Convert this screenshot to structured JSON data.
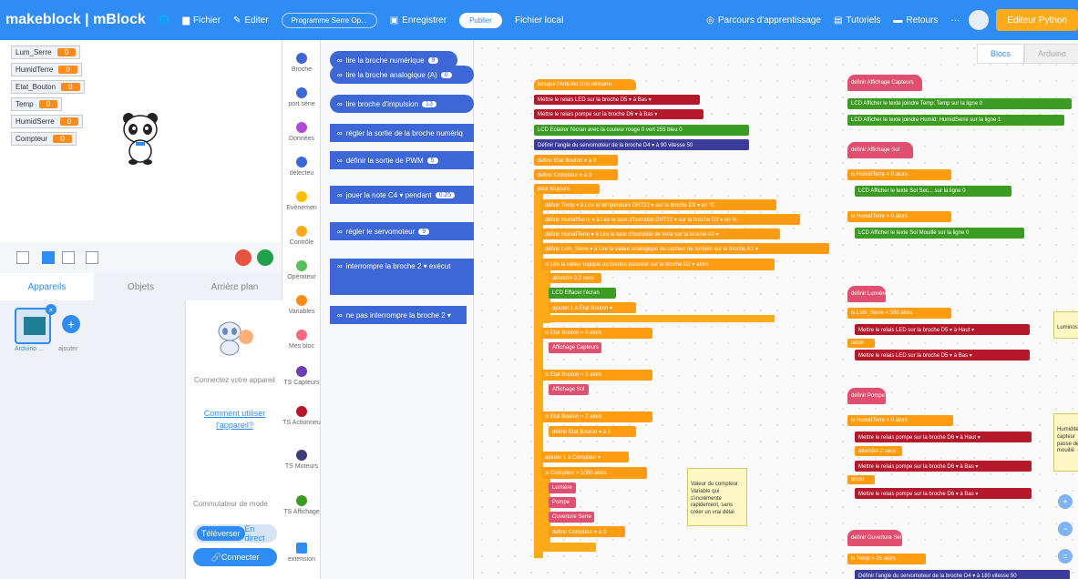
{
  "topbar": {
    "brand": "makeblock | mBlock",
    "menu_file": "Fichier",
    "menu_edit": "Editer",
    "project_name": "Programme Serre Op...",
    "save": "Enregistrer",
    "publish": "Publier",
    "local_file": "Fichier local",
    "learning": "Parcours d'apprentissage",
    "tutorials": "Tutoriels",
    "feedback": "Retours",
    "more": "···",
    "python_editor": "Editeur Python"
  },
  "variables": [
    {
      "name": "Lum_Serre",
      "value": "0"
    },
    {
      "name": "HumidTerre",
      "value": "0"
    },
    {
      "name": "Etat_Bouton",
      "value": "0"
    },
    {
      "name": "Temp",
      "value": "0"
    },
    {
      "name": "HumidSerre",
      "value": "0"
    },
    {
      "name": "Compteur",
      "value": "0"
    }
  ],
  "tabs": {
    "devices": "Appareils",
    "objects": "Objets",
    "background": "Arrière plan"
  },
  "devices": {
    "device_label": "Arduino ...",
    "add_label": "ajouter",
    "connect_text": "Connectez votre appareil",
    "how_to_link": "Comment utiliser l'appareil?",
    "mode_switch": "Commutateur de mode",
    "upload": "Téléverser",
    "live": "En direct",
    "connect_button": "Connecter"
  },
  "categories": [
    {
      "label": "Broche",
      "color": "#3d67d6"
    },
    {
      "label": "port série",
      "color": "#3d67d6"
    },
    {
      "label": "Données",
      "color": "#b04ad6"
    },
    {
      "label": "délecteu",
      "color": "#3d67d6"
    },
    {
      "label": "Evènemen",
      "color": "#ffbf00"
    },
    {
      "label": "Contrôle",
      "color": "#ffab19"
    },
    {
      "label": "Opérateur",
      "color": "#59c059"
    },
    {
      "label": "Variables",
      "color": "#ff8c1a"
    },
    {
      "label": "Mes bloc",
      "color": "#ff6680"
    },
    {
      "label": "TS Capteurs",
      "color": "#6d3eb5"
    },
    {
      "label": "TS Actionneu",
      "color": "#b5182a"
    },
    {
      "label": "TS Moteurs",
      "color": "#3c3c7b"
    },
    {
      "label": "TS Affichage",
      "color": "#3b9b22"
    },
    {
      "label": "extension",
      "color": "#2f8cf4"
    }
  ],
  "palette_blocks": [
    {
      "text": "lire la broche numérique",
      "value": "9"
    },
    {
      "text": "lire la broche analogique (A)",
      "value": "0"
    },
    {
      "text": "lire broche d'impulsion",
      "value": "13"
    },
    {
      "text": "régler la sortie de la broche numériq",
      "value": ""
    },
    {
      "text": "définir la sortie de PWM",
      "value": "5"
    },
    {
      "text": "jouer la note C4 ▾ pendant",
      "value": "0.25"
    },
    {
      "text": "régler le servomoteur",
      "value": "9"
    },
    {
      "text": "interrompre la broche 2 ▾ exécut",
      "value": ""
    },
    {
      "text": "ne pas interrompre la broche 2 ▾",
      "value": ""
    }
  ],
  "workspace_tabs": {
    "blocks": "Blocs",
    "arduino": "Arduino"
  },
  "main_script": [
    "lorsque l'Arduino Uno démarre",
    "Mettre le relais LED sur la broche D5 ▾ à Bas ▾",
    "Mettre le relais pompe sur la broche D6 ▾ à Bas ▾",
    "LCD Eclairer l'écran avec la couleur rouge 0 vert 255 bleu 0",
    "Définir l'angle du servomoteur de la broche D4 ▾ à 90 vitesse 50",
    "définir Etat Bouton ▾ à 0",
    "définir Compteur ▾ à 0",
    "pour toujours",
    "définir Temp ▾ à Lire la température DHT22 ▾ sur la broche D3 ▾ en °C",
    "définir HumidSerre ▾ à Lire le taux d'humidité DHT22 ▾ sur la broche D3 ▾ en %",
    "définir HumidTerre ▾ à Lire le taux d'humidité de terre sur la broche A0 ▾",
    "définir Lum_Serre ▾ à Lire la valeur analogique du capteur de lumière sur la broche A1 ▾",
    "si Lire la valeur logique du bouton poussoir sur la broche D2 ▾ alors",
    "attendre 0.2 secs",
    "LCD Effacer l'écran",
    "ajouter 1 à Etat Bouton ▾",
    "si Etat Bouton = 0 alors",
    "Affichage Capteurs",
    "si Etat Bouton = 1 alors",
    "Affichage Sol",
    "si Etat Bouton = 2 alors",
    "définir Etat Bouton ▾ à 0",
    "ajouter 1 à Compteur ▾",
    "si Compteur > 1000 alors",
    "Lumière",
    "Pompe",
    "Ouverture Serre",
    "définir Compteur ▾ à 0"
  ],
  "note_counter": "Valeur du compteur Variable qui s'incrémente rapidement, sans créer un vrai délai",
  "define_capteurs": [
    "définir Affichage Capteurs",
    "LCD Afficher le texte joindre Temp: Temp sur la ligne 0",
    "LCD Afficher le texte joindre Humid: HumidSerre sur la ligne 1"
  ],
  "define_sol": [
    "définir Affichage Sol",
    "si HumidTerre < 0 alors",
    "LCD Afficher le texte Sol Sec... sur la ligne 0",
    "si HumidTerre > 0 alors",
    "LCD Afficher le texte Sol Mouillé sur la ligne 0"
  ],
  "define_lumiere": [
    "définir Lumière",
    "si Lum_Serre < 500 alors",
    "Mettre le relais LED sur la broche D5 ▾ à Haut ▾",
    "sinon",
    "Mettre le relais LED sur la broche D5 ▾ à Bas ▾"
  ],
  "note_lumiere": "Luminosité",
  "define_pompe": [
    "définir Pompe",
    "si HumidTerre < 0 alors",
    "Mettre le relais pompe sur la broche D6 ▾ à Haut ▾",
    "attendre 2 secs",
    "Mettre le relais pompe sur la broche D6 ▾ à Bas ▾",
    "sinon",
    "Mettre le relais pompe sur la broche D6 ▾ à Bas ▾"
  ],
  "note_pompe": "Humidité capteur passe de mouillé",
  "define_ouverture": [
    "définir Ouverture Serre",
    "si Temp > 25 alors",
    "Définir l'angle du servomoteur de la broche D4 ▾ à 180 vitesse 50"
  ]
}
